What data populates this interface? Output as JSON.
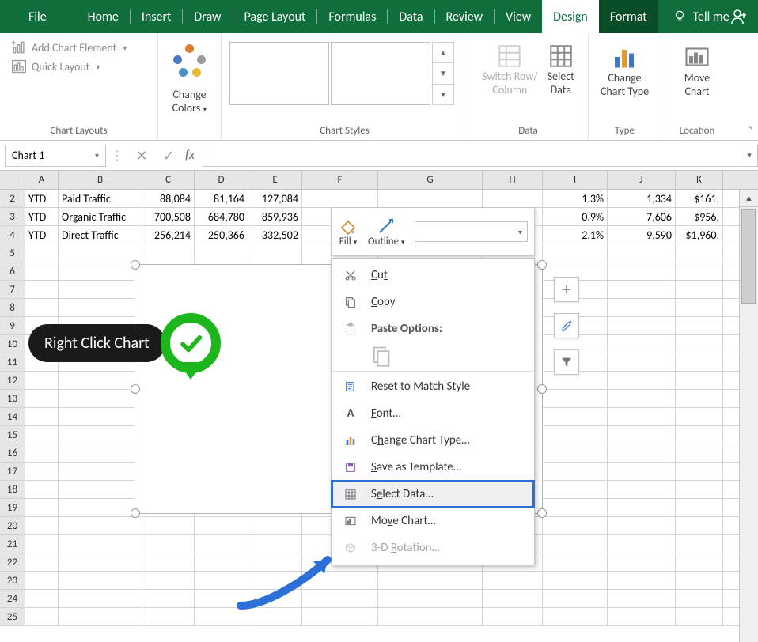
{
  "tabs": {
    "file": "File",
    "home": "Home",
    "insert": "Insert",
    "draw": "Draw",
    "page": "Page Layout",
    "formulas": "Formulas",
    "data": "Data",
    "review": "Review",
    "view": "View",
    "design": "Design",
    "format": "Format",
    "tell": "Tell me"
  },
  "ribbon": {
    "layouts": {
      "add": "Add Chart Element",
      "quick": "Quick Layout",
      "label": "Chart Layouts"
    },
    "colors": {
      "label": "Change Colors"
    },
    "styles": {
      "label": "Chart Styles"
    },
    "data": {
      "switch": "Switch Row/",
      "switch2": "Column",
      "select": "Select",
      "select2": "Data",
      "label": "Data"
    },
    "type": {
      "change": "Change",
      "change2": "Chart Type",
      "label": "Type"
    },
    "loc": {
      "move": "Move",
      "move2": "Chart",
      "label": "Location"
    }
  },
  "fbar": {
    "name": "Chart 1",
    "fx": "fx"
  },
  "cols": [
    "A",
    "B",
    "C",
    "D",
    "E",
    "F",
    "G",
    "H",
    "I",
    "J",
    "K"
  ],
  "rows": [
    {
      "n": "2",
      "A": "YTD",
      "B": "Paid Traffic",
      "C": "88,084",
      "D": "81,164",
      "E": "127,084",
      "I": "1.3%",
      "J": "1,334",
      "K": "$161,"
    },
    {
      "n": "3",
      "A": "YTD",
      "B": "Organic Traffic",
      "C": "700,508",
      "D": "684,780",
      "E": "859,936",
      "I": "0.9%",
      "J": "7,606",
      "K": "$956,"
    },
    {
      "n": "4",
      "A": "YTD",
      "B": "Direct Traffic",
      "C": "256,214",
      "D": "250,366",
      "E": "332,502",
      "I": "2.1%",
      "J": "9,590",
      "K": "$1,960,"
    }
  ],
  "blank_rows": [
    "5",
    "6",
    "7",
    "8",
    "9",
    "10",
    "11",
    "12",
    "13",
    "14",
    "15",
    "16",
    "17",
    "18",
    "19",
    "20",
    "21",
    "22",
    "23",
    "24",
    "25"
  ],
  "minitb": {
    "fill": "Fill",
    "outline": "Outline"
  },
  "ctx": {
    "cut": "Cut",
    "copy": "Copy",
    "paste": "Paste Options:",
    "reset": "Reset to Match Style",
    "font": "Font…",
    "changetype": "Change Chart Type…",
    "savetmpl": "Save as Template…",
    "selectdata": "Select Data…",
    "movechart": "Move Chart…",
    "rot": "3-D Rotation…"
  },
  "callout": "Right Click Chart"
}
